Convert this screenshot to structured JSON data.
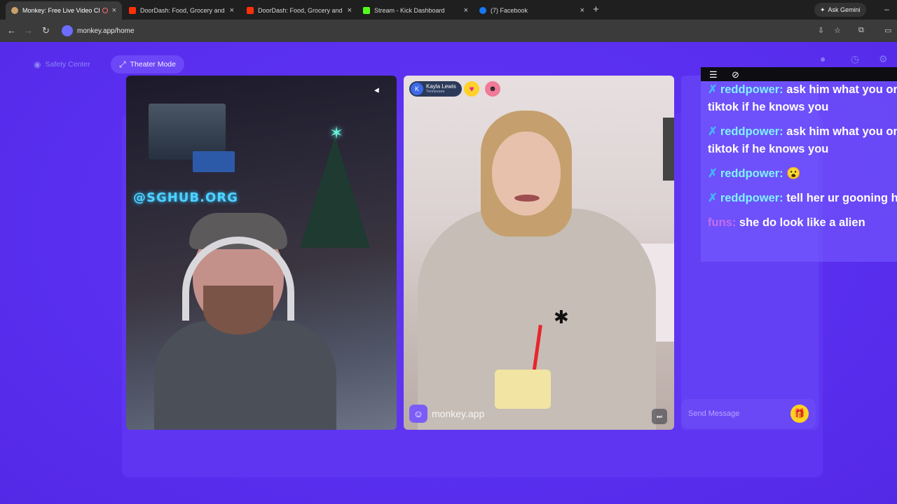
{
  "browser": {
    "tabs": [
      {
        "title": "Monkey: Free Live Video Ch",
        "active": true,
        "favicon_color": "#c9a06a"
      },
      {
        "title": "DoorDash: Food, Grocery and F",
        "active": false,
        "favicon_color": "#ff3008"
      },
      {
        "title": "DoorDash: Food, Grocery and F",
        "active": false,
        "favicon_color": "#ff3008"
      },
      {
        "title": "Stream - Kick Dashboard",
        "active": false,
        "favicon_color": "#53fc18"
      },
      {
        "title": "(7) Facebook",
        "active": false,
        "favicon_color": "#1877f2"
      }
    ],
    "gemini_label": "Ask Gemini",
    "url": "monkey.app/home"
  },
  "header": {
    "safety_label": "Safety Center",
    "theater_label": "Theater Mode"
  },
  "video_left": {
    "neon_sign": "@SGHUB.ORG"
  },
  "video_right": {
    "user_initial": "K",
    "user_name": "Kayla Lewis",
    "user_location": "Tennessee",
    "watermark": "monkey.app"
  },
  "chat": {
    "send_placeholder": "Send Message"
  },
  "overlay": {
    "messages": [
      {
        "user": "reddpower:",
        "text": "ask him what you on tiktok if he knows you",
        "color": "cyan"
      },
      {
        "user": "reddpower:",
        "text": "ask him what you on tiktok if he knows you",
        "color": "cyan"
      },
      {
        "user": "reddpower:",
        "text": "😮",
        "color": "cyan"
      },
      {
        "user": "reddpower:",
        "text": "tell her ur gooning her",
        "color": "cyan"
      },
      {
        "user": "funs:",
        "text": "she do look like a alien",
        "color": "purple"
      }
    ]
  },
  "colors": {
    "page_bg": "#5a2ff0",
    "accent_yellow": "#ffd21f",
    "chat_user": "#7ff2ff",
    "chat_user_alt": "#c56cf0"
  }
}
